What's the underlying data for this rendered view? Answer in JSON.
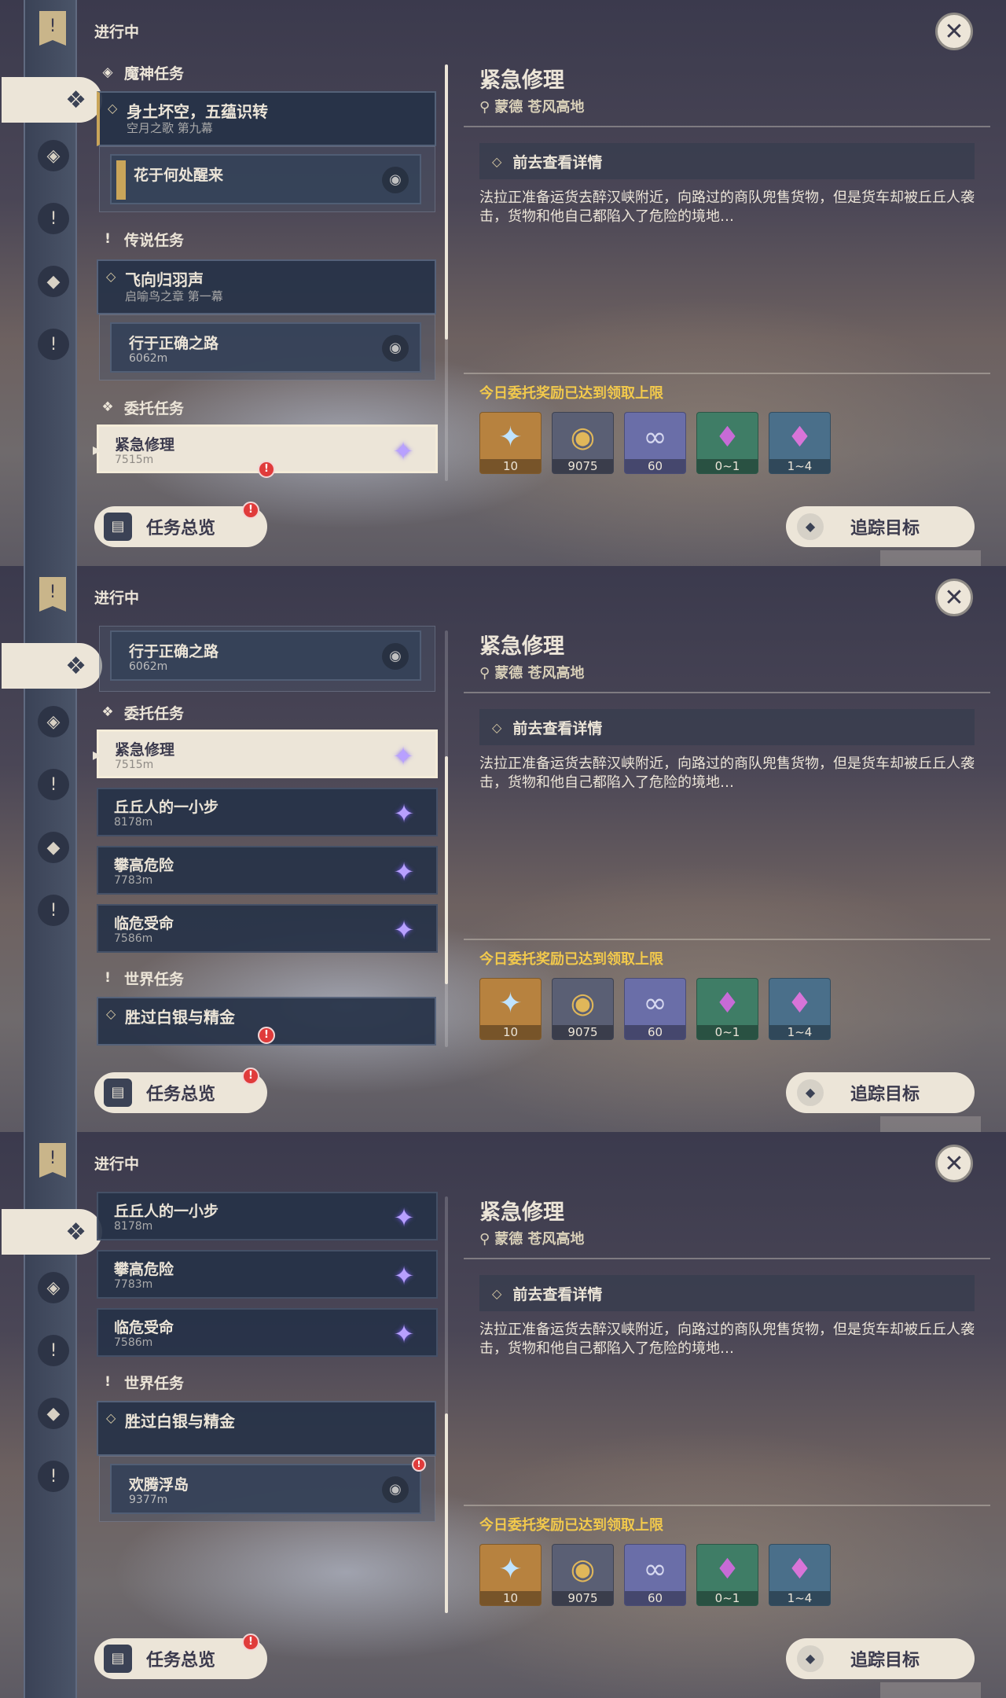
{
  "ui": {
    "in_progress": "进行中",
    "close_icon": "✕",
    "overview_label": "任务总览",
    "track_label": "追踪目标",
    "badge": "!"
  },
  "categories": {
    "archon": "魔神任务",
    "legend": "传说任务",
    "commission": "委托任务",
    "world": "世界任务"
  },
  "quests": {
    "archon_main": {
      "title": "身土坏空，五蕴识转",
      "subtitle": "空月之歌 第九幕"
    },
    "archon_sub": {
      "title": "花于何处醒来"
    },
    "legend_main": {
      "title": "飞向归羽声",
      "subtitle": "启喻鸟之章 第一幕"
    },
    "legend_sub": {
      "title": "行于正确之路",
      "distance": "6062m"
    },
    "commissions": [
      {
        "title": "紧急修理",
        "distance": "7515m"
      },
      {
        "title": "丘丘人的一小步",
        "distance": "8178m"
      },
      {
        "title": "攀高危险",
        "distance": "7783m"
      },
      {
        "title": "临危受命",
        "distance": "7586m"
      }
    ],
    "world_main": {
      "title": "胜过白银与精金"
    },
    "world_sub": {
      "title": "欢腾浮岛",
      "distance": "9377m"
    }
  },
  "detail": {
    "title": "紧急修理",
    "location": "蒙德 苍风高地",
    "go_label": "前去查看详情",
    "description": "法拉正准备运货去醉汉峡附近，向路过的商队兜售货物，但是货车却被丘丘人袭击，货物和他自己都陷入了危险的境地…",
    "limit_note": "今日委托奖励已达到领取上限",
    "rewards": [
      {
        "icon": "star-icon",
        "glyph": "✦",
        "count": "10",
        "color": "#b7823f"
      },
      {
        "icon": "mora-coin-icon",
        "glyph": "◉",
        "count": "9075",
        "color": "#5a5f74"
      },
      {
        "icon": "fate-ring-icon",
        "glyph": "∞",
        "count": "60",
        "color": "#6a6ea8"
      },
      {
        "icon": "crystal-icon",
        "glyph": "♦",
        "count": "0~1",
        "color": "#3f7d66"
      },
      {
        "icon": "crystal-cluster-icon",
        "glyph": "♦",
        "count": "1~4",
        "color": "#4a6f8a"
      }
    ]
  },
  "colors": {
    "accent": "#ece5d8",
    "gold": "#c9a55a",
    "limit": "#f2c94c",
    "alert": "#e03b3b"
  }
}
